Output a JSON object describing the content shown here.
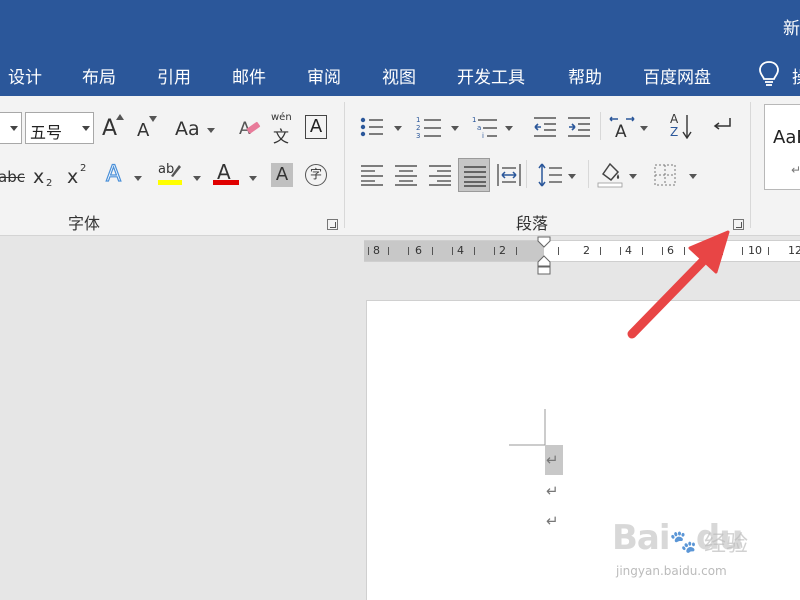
{
  "window": {
    "title_partial": "新"
  },
  "tabs": [
    {
      "label": "设计"
    },
    {
      "label": "布局"
    },
    {
      "label": "引用"
    },
    {
      "label": "邮件"
    },
    {
      "label": "审阅"
    },
    {
      "label": "视图"
    },
    {
      "label": "开发工具"
    },
    {
      "label": "帮助"
    },
    {
      "label": "百度网盘"
    }
  ],
  "tell_me_partial": "操",
  "font_group": {
    "label": "字体",
    "font_size": "五号",
    "grow_font": "A",
    "shrink_font": "A",
    "change_case": "Aa",
    "phonetic_top": "wén",
    "phonetic_bottom": "文",
    "char_border": "A",
    "strikethrough": "abc",
    "subscript": "x",
    "subscript_mark": "2",
    "superscript": "x",
    "superscript_mark": "2",
    "text_effects": "A",
    "highlight": "ab",
    "font_color": "A",
    "char_shading": "A",
    "enclose_char": "字"
  },
  "paragraph_group": {
    "label": "段落",
    "sort": "A",
    "sort_bottom": "Z"
  },
  "styles_group": {
    "preview": "AaB"
  },
  "ruler": {
    "left_labels": [
      "8",
      "6",
      "4",
      "2"
    ],
    "right_labels": [
      "2",
      "4",
      "6",
      "10",
      "12"
    ]
  },
  "document": {
    "paragraph_mark": "↵"
  },
  "watermark": {
    "brand": "Bai",
    "brand2": "du",
    "cn": "经验",
    "url": "jingyan.baidu.com"
  },
  "colors": {
    "title_bar": "#2b579a",
    "ribbon": "#f3f3f3",
    "highlight_yellow": "#ffff00",
    "font_red": "#e00000",
    "text_effect_blue": "#4a90d9",
    "arrow_red": "#e84545"
  }
}
